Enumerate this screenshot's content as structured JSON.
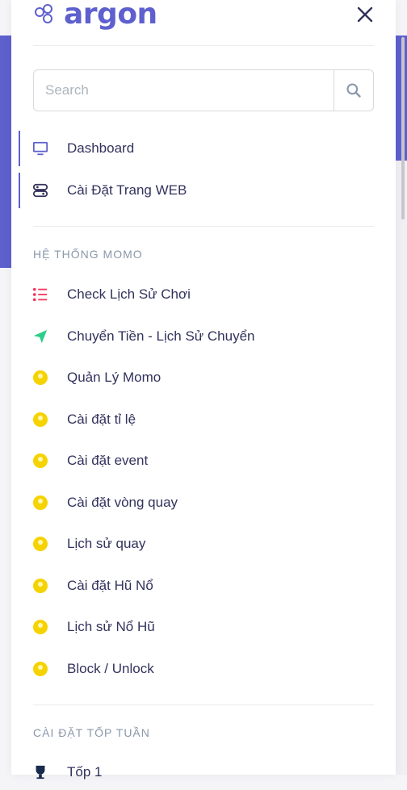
{
  "brand": {
    "name": "argon"
  },
  "search": {
    "placeholder": "Search"
  },
  "nav_main": [
    {
      "label": "Dashboard",
      "icon": "monitor-icon"
    },
    {
      "label": "Cài Đặt Trang WEB",
      "icon": "settings-icon"
    }
  ],
  "section_momo": {
    "heading": "HỆ THỐNG MOMO",
    "items": [
      {
        "label": "Check Lịch Sử Chơi",
        "icon": "list-icon"
      },
      {
        "label": "Chuyển Tiền - Lịch Sử Chuyển",
        "icon": "send-icon"
      },
      {
        "label": "Quản Lý Momo",
        "icon": "user-icon"
      },
      {
        "label": "Cài đặt tỉ lệ",
        "icon": "user-icon"
      },
      {
        "label": "Cài đặt event",
        "icon": "user-icon"
      },
      {
        "label": "Cài đặt vòng quay",
        "icon": "user-icon"
      },
      {
        "label": "Lịch sử quay",
        "icon": "user-icon"
      },
      {
        "label": "Cài đặt Hũ Nổ",
        "icon": "user-icon"
      },
      {
        "label": "Lịch sử Nổ Hũ",
        "icon": "user-icon"
      },
      {
        "label": "Block / Unlock",
        "icon": "user-icon"
      }
    ]
  },
  "section_top": {
    "heading": "CÀI ĐẶT TỐP TUẦN",
    "items": [
      {
        "label": "Tốp 1",
        "icon": "trophy-icon"
      }
    ]
  },
  "colors": {
    "accent": "#5e60ce",
    "text": "#32325d",
    "muted": "#8898aa",
    "user_icon": "#f5d300",
    "list_icon": "#f5365c",
    "send_icon": "#2dce89"
  }
}
